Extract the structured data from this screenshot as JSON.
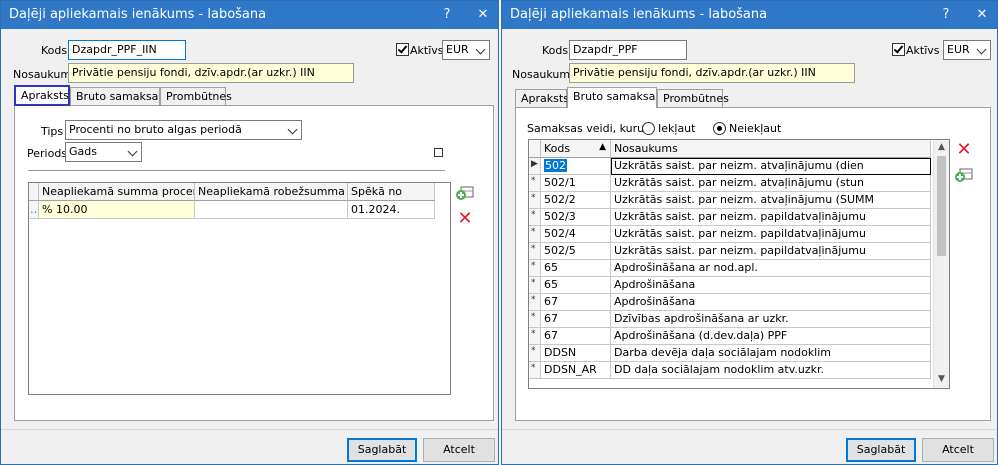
{
  "left": {
    "title": "Daļēji apliekamais ienākums - labošana",
    "kods_label": "Kods",
    "kods_value": "Dzapdr_PPF_IIN",
    "aktivs_label": "Aktīvs",
    "currency": "EUR",
    "nosaukums_label": "Nosaukums",
    "nosaukums_value": "Privātie pensiju fondi, dzīv.apdr.(ar uzkr.) IIN",
    "tabs": [
      "Apraksts",
      "Bruto samaksa",
      "Prombūtnes"
    ],
    "tips_label": "Tips",
    "tips_value": "Procenti no bruto algas periodā",
    "periods_label": "Periods",
    "periods_value": "Gads",
    "grid": {
      "headers": [
        "Neapliekamā summa procentos",
        "Neapliekamā robežsumma",
        "Spēkā no"
      ],
      "rows": [
        [
          "% 10.00",
          "",
          "01.2024."
        ]
      ]
    }
  },
  "right": {
    "title": "Daļēji apliekamais ienākums - labošana",
    "kods_label": "Kods",
    "kods_value": "Dzapdr_PPF",
    "aktivs_label": "Aktīvs",
    "currency": "EUR",
    "nosaukums_label": "Nosaukums",
    "nosaukums_value": "Privātie pensiju fondi, dzīv.apdr.(ar uzkr.) IIN",
    "tabs": [
      "Apraksts",
      "Bruto samaksa",
      "Prombūtnes"
    ],
    "samaksas_label": "Samaksas veidi, kurus",
    "radio_iekl": "Iekļaut",
    "radio_neiekl": "Neiekļaut",
    "grid": {
      "headers": [
        "Kods",
        "Nosaukums"
      ],
      "rows": [
        [
          "502",
          "Uzkrātās saist. par neizm. atvaļinājumu (dien"
        ],
        [
          "502/1",
          "Uzkrātās saist. par neizm. atvaļinājumu (stun"
        ],
        [
          "502/2",
          "Uzkrātās saist. par neizm. atvaļinājumu (SUMM"
        ],
        [
          "502/3",
          "Uzkrātās saist. par neizm. papildatvaļinājumu"
        ],
        [
          "502/4",
          "Uzkrātās saist. par neizm. papildatvaļinājumu"
        ],
        [
          "502/5",
          "Uzkrātās saist. par neizm. papildatvaļinājumu"
        ],
        [
          "65",
          "Apdrošināšana ar nod.apl."
        ],
        [
          "65",
          "Apdrošināšana"
        ],
        [
          "67",
          "Apdrošināšana"
        ],
        [
          "67",
          "Dzīvības apdrošināšana ar uzkr."
        ],
        [
          "67",
          "Apdrošināšana  (d.dev.daļa) PPF"
        ],
        [
          "DDSN",
          "Darba devēja daļa sociālajam nodoklim"
        ],
        [
          "DDSN_AR",
          "DD daļa sociālajam nodoklim atv.uzkr."
        ]
      ]
    }
  },
  "buttons": {
    "save": "Saglabāt",
    "cancel": "Atcelt"
  },
  "titlebar": {
    "help": "?",
    "close": "✕"
  }
}
